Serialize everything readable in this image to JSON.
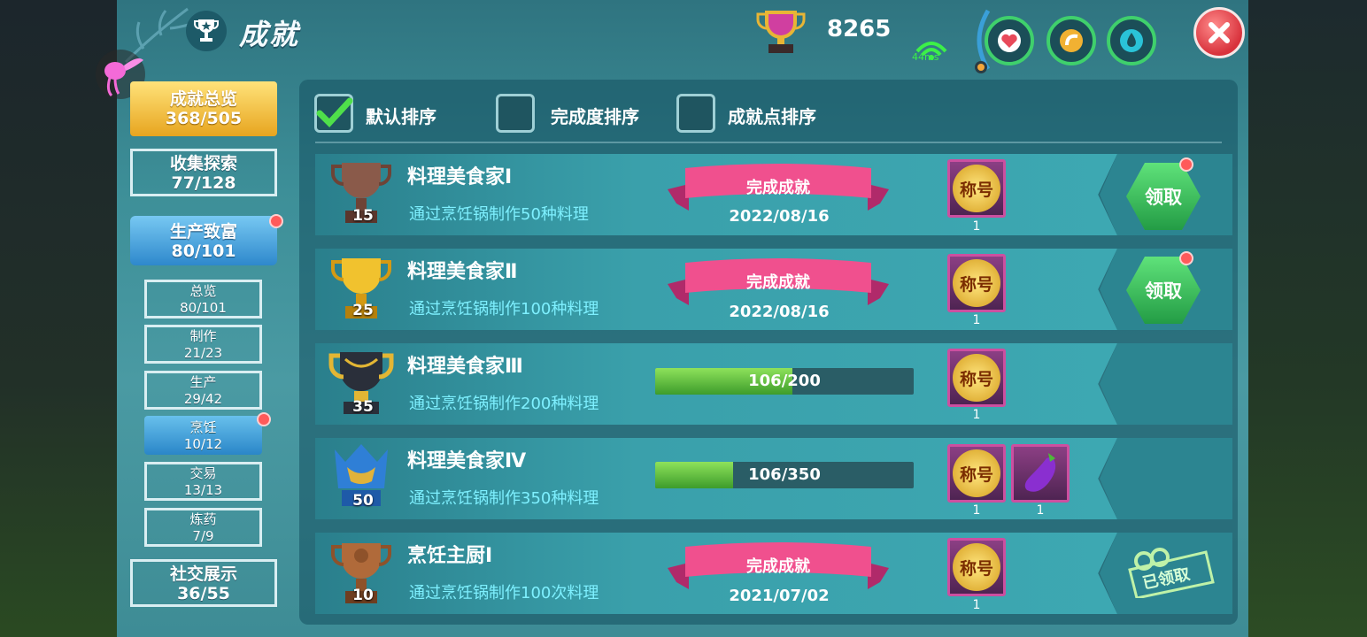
{
  "header": {
    "title": "成就",
    "points": "8265",
    "ping": "44ms"
  },
  "colors": {
    "panel": "#3d8f98",
    "accent_green": "#3fd06c",
    "gold": "#e7a51f",
    "claim_green": "#239c45",
    "ribbon_pink": "#f0508e"
  },
  "nav": {
    "overview": {
      "label": "成就总览",
      "count": "368/505"
    },
    "collect": {
      "label": "收集探索",
      "count": "77/128"
    },
    "produce": {
      "label": "生产致富",
      "count": "80/101"
    },
    "sub": [
      {
        "label": "总览",
        "count": "80/101"
      },
      {
        "label": "制作",
        "count": "21/23"
      },
      {
        "label": "生产",
        "count": "29/42"
      },
      {
        "label": "烹饪",
        "count": "10/12"
      },
      {
        "label": "交易",
        "count": "13/13"
      },
      {
        "label": "炼药",
        "count": "7/9"
      }
    ],
    "social": {
      "label": "社交展示",
      "count": "36/55"
    }
  },
  "sort": {
    "default": "默认排序",
    "completion": "完成度排序",
    "points": "成就点排序"
  },
  "achievements": [
    {
      "title": "料理美食家Ⅰ",
      "desc": "通过烹饪锅制作50种料理",
      "level": "15",
      "status": "完成成就",
      "date": "2022/08/16",
      "reward": "称号",
      "reward_count": "1",
      "action": "领取"
    },
    {
      "title": "料理美食家Ⅱ",
      "desc": "通过烹饪锅制作100种料理",
      "level": "25",
      "status": "完成成就",
      "date": "2022/08/16",
      "reward": "称号",
      "reward_count": "1",
      "action": "领取"
    },
    {
      "title": "料理美食家Ⅲ",
      "desc": "通过烹饪锅制作200种料理",
      "level": "35",
      "progress": "106/200",
      "progress_value": 0.53,
      "reward": "称号",
      "reward_count": "1"
    },
    {
      "title": "料理美食家Ⅳ",
      "desc": "通过烹饪锅制作350种料理",
      "level": "50",
      "progress": "106/350",
      "progress_value": 0.3,
      "reward": "称号",
      "reward_count": "1",
      "reward2_count": "1"
    },
    {
      "title": "烹饪主厨Ⅰ",
      "desc": "通过烹饪锅制作100次料理",
      "level": "10",
      "status": "完成成就",
      "date": "2021/07/02",
      "reward": "称号",
      "reward_count": "1",
      "action": "已领取"
    }
  ]
}
